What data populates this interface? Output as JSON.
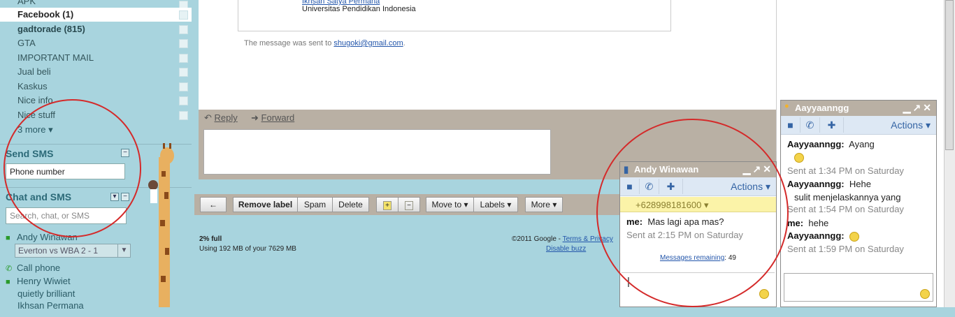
{
  "sidebar": {
    "labels": [
      {
        "label": "APK",
        "bold": false,
        "selected": false
      },
      {
        "label": "Facebook (1)",
        "bold": true,
        "selected": true
      },
      {
        "label": "gadtorade (815)",
        "bold": true,
        "selected": false
      },
      {
        "label": "GTA",
        "bold": false,
        "selected": false
      },
      {
        "label": "IMPORTANT MAIL",
        "bold": false,
        "selected": false
      },
      {
        "label": "Jual beli",
        "bold": false,
        "selected": false
      },
      {
        "label": "Kaskus",
        "bold": false,
        "selected": false
      },
      {
        "label": "Nice info",
        "bold": false,
        "selected": false
      },
      {
        "label": "Nice stuff",
        "bold": false,
        "selected": false
      }
    ],
    "more_link": "3 more ▾",
    "send_sms": {
      "title": "Send SMS",
      "phone_value": "Phone number"
    },
    "chat_sms": {
      "title": "Chat and SMS",
      "search_placeholder": "Search, chat, or SMS"
    },
    "contacts": {
      "me": "Andy Winawan",
      "status": "Everton vs WBA 2 - 1",
      "call_phone": "Call phone",
      "henry": "Henry Wiwiet",
      "henry_status": "quietly brilliant",
      "next": "Ikhsan Permana"
    }
  },
  "mail": {
    "sig_name": "Ikhsan Satya Permana",
    "sig_org": "Universitas Pendidikan Indonesia",
    "sent_note_prefix": "The message was sent to ",
    "sent_to": "shugoki@gmail.com",
    "sent_note_suffix": ".",
    "reply": "Reply",
    "forward": "Forward",
    "toolbar": {
      "back": "←",
      "remove_label": "Remove label",
      "spam": "Spam",
      "delete": "Delete",
      "move_to": "Move to ▾",
      "labels": "Labels ▾",
      "more": "More ▾"
    },
    "storage_pct": "2% full",
    "storage_detail": "Using 192 MB of your 7629 MB",
    "copyright": "©2011 Google - ",
    "terms": "Terms & Privacy",
    "disable_buzz": "Disable buzz"
  },
  "chat_andy": {
    "name": "Andy Winawan",
    "actions": "Actions ▾",
    "phone": "+628998181600 ▾",
    "messages": [
      {
        "sender": "me:",
        "text": "Mas lagi apa mas?"
      },
      {
        "stamp": "Sent at 2:15 PM on Saturday"
      }
    ],
    "remaining_label": "Messages remaining",
    "remaining_count": ": 49",
    "input_value": "|"
  },
  "chat_aay": {
    "name": "Aayyaanngg",
    "actions": "Actions ▾",
    "m1_sender": "Aayyaanngg:",
    "m1_text": "Ayang",
    "s1": "Sent at 1:34 PM on Saturday",
    "m2_sender": "Aayyaanngg:",
    "m2_text": "Hehe",
    "m2_text2": "sulit menjelaskannya yang",
    "s2": "Sent at 1:54 PM on Saturday",
    "m3_sender": "me:",
    "m3_text": "hehe",
    "m4_sender": "Aayyaanngg:",
    "s3": "Sent at 1:59 PM on Saturday"
  },
  "colors": {
    "sidebar_bg": "#a8d4de",
    "chat_title": "#b9b0a4",
    "annotation": "#d42a2a"
  }
}
